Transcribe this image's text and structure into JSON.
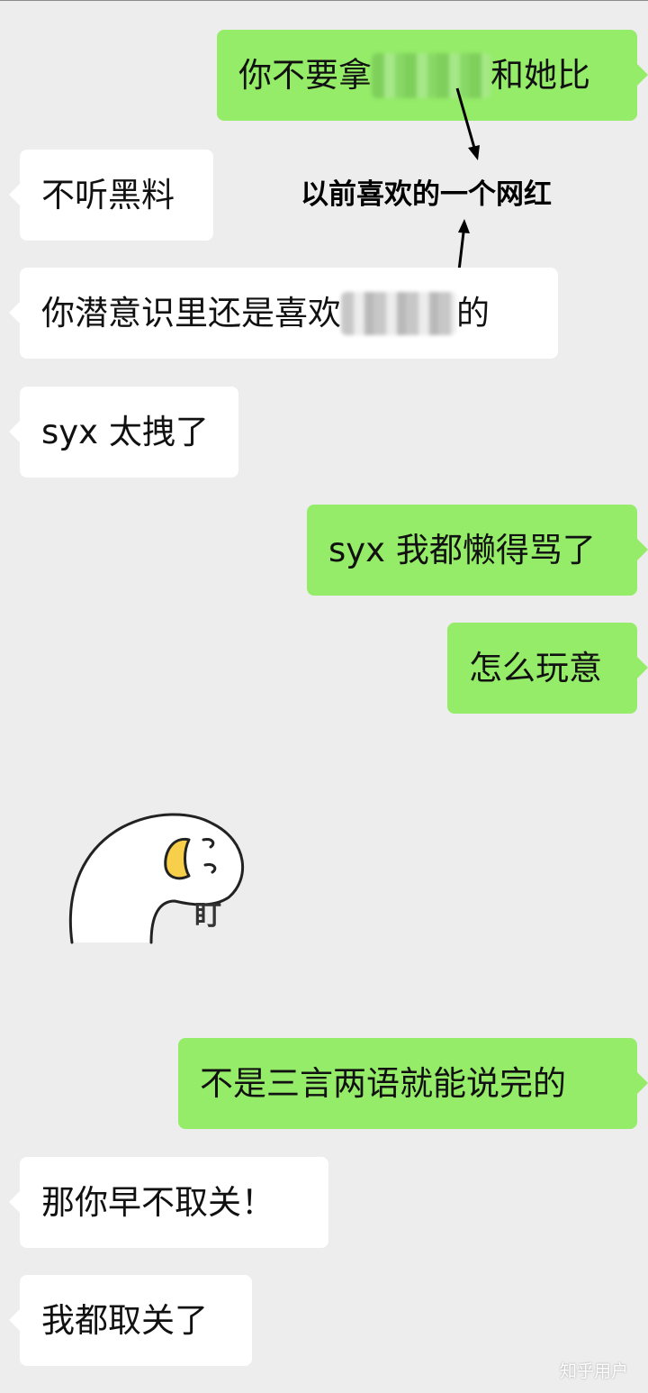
{
  "messages": [
    {
      "side": "out",
      "text_before": "你不要拿",
      "text_after": "和她比",
      "redacted": true
    },
    {
      "side": "in",
      "text": "不听黑料"
    },
    {
      "side": "in",
      "text_before": "你潜意识里还是喜欢",
      "text_after": "的",
      "redacted": true
    },
    {
      "side": "in",
      "text": "syx 太拽了"
    },
    {
      "side": "out",
      "text": "syx 我都懒得骂了"
    },
    {
      "side": "out",
      "text": "怎么玩意"
    },
    {
      "side": "in",
      "sticker": "duck-stare-sticker",
      "sticker_text": "盯"
    },
    {
      "side": "out",
      "text": "不是三言两语就能说完的"
    },
    {
      "side": "in",
      "text": "那你早不取关！"
    },
    {
      "side": "in",
      "text": "我都取关了"
    }
  ],
  "annotation": {
    "text": "以前喜欢的一个网红"
  },
  "watermark": "知乎用户",
  "colors": {
    "background": "#ededed",
    "incoming_bubble": "#ffffff",
    "outgoing_bubble": "#95ec69"
  }
}
